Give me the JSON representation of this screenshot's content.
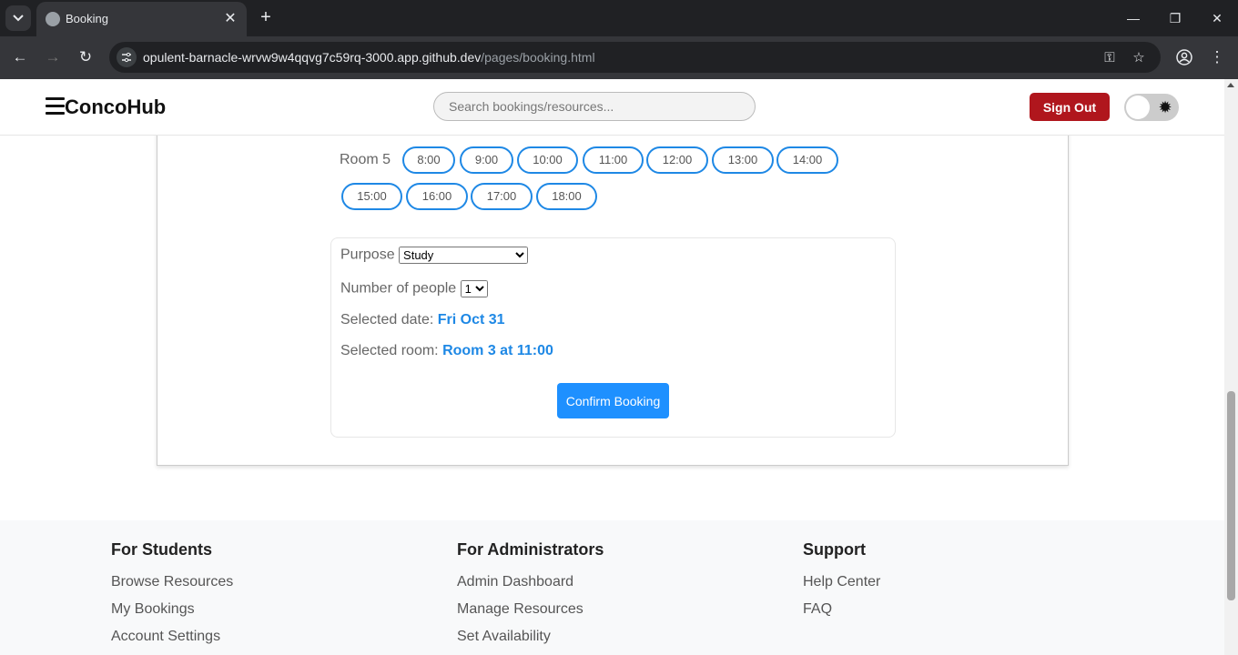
{
  "browser": {
    "tab_title": "Booking",
    "url_host": "opulent-barnacle-wrvw9w4qqvg7c59rq-3000.app.github.dev",
    "url_path": "/pages/booking.html"
  },
  "header": {
    "brand": "ConcoHub",
    "search_placeholder": "Search bookings/resources...",
    "signout_label": "Sign Out"
  },
  "schedule": {
    "room_label": "Room 5",
    "slots": [
      "8:00",
      "9:00",
      "10:00",
      "11:00",
      "12:00",
      "13:00",
      "14:00",
      "15:00",
      "16:00",
      "17:00",
      "18:00"
    ]
  },
  "form": {
    "purpose_label": "Purpose",
    "purpose_value": "Study",
    "people_label": "Number of people",
    "people_value": "1",
    "date_label": "Selected date:",
    "date_value": "Fri Oct 31",
    "room_label": "Selected room:",
    "room_value": "Room 3 at 11:00",
    "confirm_label": "Confirm Booking"
  },
  "footer": {
    "students": {
      "title": "For Students",
      "links": [
        "Browse Resources",
        "My Bookings",
        "Account Settings"
      ]
    },
    "admins": {
      "title": "For Administrators",
      "links": [
        "Admin Dashboard",
        "Manage Resources",
        "Set Availability"
      ]
    },
    "support": {
      "title": "Support",
      "links": [
        "Help Center",
        "FAQ"
      ]
    }
  },
  "colors": {
    "accent": "#1e88e5",
    "signout": "#b0161d",
    "confirm": "#1e90ff"
  }
}
